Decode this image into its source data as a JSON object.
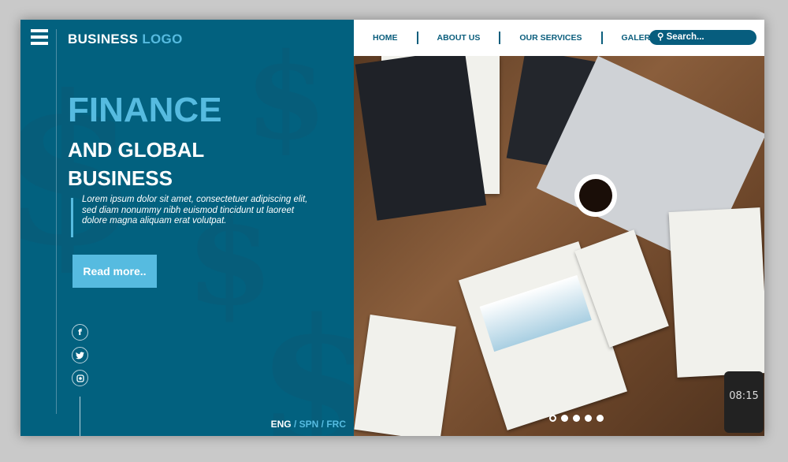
{
  "brand": {
    "name": "BUSINESS",
    "highlight": "LOGO"
  },
  "hero": {
    "title": "FINANCE",
    "subtitle_line1": "AND GLOBAL",
    "subtitle_line2": "BUSINESS",
    "body": "Lorem ipsum dolor sit amet, consectetuer adipiscing elit, sed diam nonummy nibh euismod tincidunt ut laoreet dolore magna aliquam erat volutpat.",
    "cta": "Read more.."
  },
  "social": [
    {
      "icon": "facebook-icon",
      "glyph": "f"
    },
    {
      "icon": "twitter-icon",
      "glyph": "t"
    },
    {
      "icon": "instagram-icon",
      "glyph": "◙"
    }
  ],
  "languages": {
    "active": "ENG",
    "others": [
      "SPN",
      "FRC"
    ],
    "sep": " / "
  },
  "nav": {
    "items": [
      "HOME",
      "ABOUT US",
      "OUR SERVICES",
      "GALERY"
    ],
    "search_placeholder": "Search..."
  },
  "slider": {
    "count": 5,
    "active": 1
  },
  "photo": {
    "clock": "08:15"
  },
  "colors": {
    "primary": "#02617f",
    "accent": "#56bbe0"
  }
}
